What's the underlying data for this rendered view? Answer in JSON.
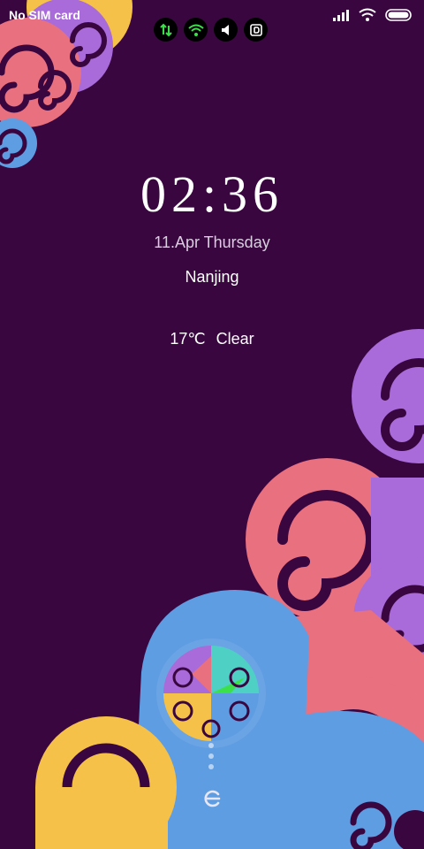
{
  "status_bar": {
    "carrier": "No SIM card",
    "notification_icons": [
      "data-transfer-icon",
      "wifi-hotspot-icon",
      "sound-icon",
      "bd-app-icon"
    ],
    "system_icons": [
      "signal-icon",
      "wifi-icon",
      "battery-icon"
    ]
  },
  "lockscreen": {
    "time": "02:36",
    "date": "11.Apr Thursday",
    "city": "Nanjing",
    "temperature": "17℃",
    "condition": "Clear"
  },
  "colors": {
    "background": "#3a0640",
    "purple": "#a96bd9",
    "pink": "#e8707f",
    "blue": "#5f9de3",
    "yellow": "#f5c148",
    "teal": "#4fd0c4"
  },
  "unlock": {
    "icon": "unlock-swipe-icon"
  }
}
